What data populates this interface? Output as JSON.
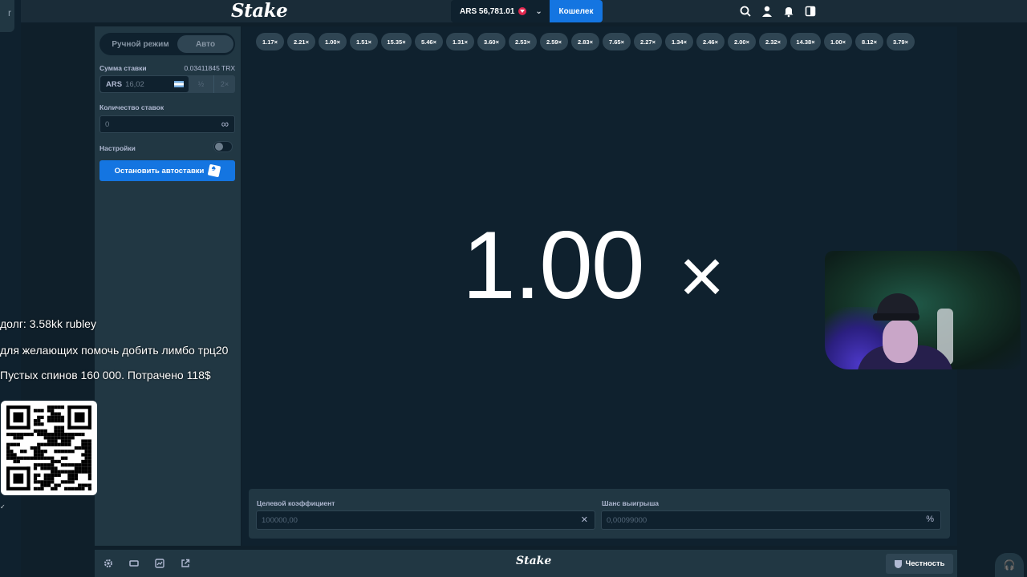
{
  "header": {
    "logo": "Stake",
    "balance": "ARS 56,781.01",
    "wallet_label": "Кошелек",
    "icons": [
      "search-icon",
      "user-icon",
      "bell-icon",
      "sidebar-toggle-icon"
    ]
  },
  "left_rail": {
    "tab_glyph": "r"
  },
  "panel": {
    "mode_manual": "Ручной режим",
    "mode_auto": "Авто",
    "bet_amount_label": "Сумма ставки",
    "bet_amount_crypto": "0.03411845 TRX",
    "bet_currency": "ARS",
    "bet_value": "16,02",
    "half_label": "½",
    "double_label": "2×",
    "bet_count_label": "Количество ставок",
    "bet_count_value": "0",
    "infinity_glyph": "∞",
    "settings_label": "Настройки",
    "stop_autobet_label": "Остановить автоставки"
  },
  "game": {
    "history": [
      "1.17×",
      "2.21×",
      "1.00×",
      "1.51×",
      "15.35×",
      "5.46×",
      "1.31×",
      "3.60×",
      "2.53×",
      "2.59×",
      "2.83×",
      "7.65×",
      "2.27×",
      "1.34×",
      "2.46×",
      "2.00×",
      "2.32×",
      "14.38×",
      "1.00×",
      "8.12×",
      "3.79×"
    ],
    "result_value": "1.00",
    "result_suffix": "×",
    "target_label": "Целевой коэффициент",
    "target_value": "100000,00",
    "target_suffix": "✕",
    "win_chance_label": "Шанс выигрыша",
    "win_chance_value": "0,00099000",
    "win_chance_suffix": "%"
  },
  "footer": {
    "logo": "Stake",
    "fairness_label": "Честность",
    "icons": [
      "settings-icon",
      "theater-mode-icon",
      "stats-icon",
      "popout-icon"
    ]
  },
  "stream_overlay": {
    "line1": "долг: 3.58kk rubley",
    "line2": "для желающих помочь добить лимбо трц20",
    "line3": "Пустых спинов 160 000. Потрачено 118$"
  },
  "colors": {
    "bg": "#0f212e",
    "panel": "#213743",
    "accent": "#1475e1",
    "chip": "#2f4553"
  }
}
